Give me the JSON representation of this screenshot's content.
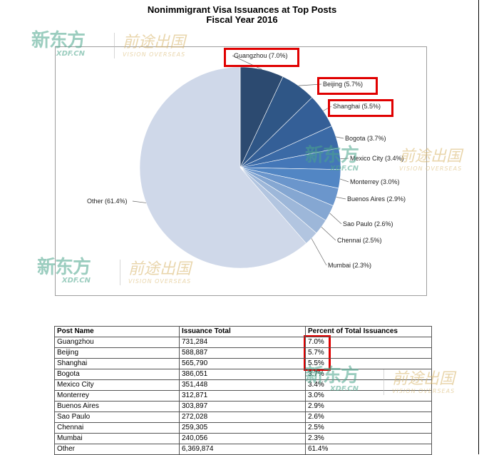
{
  "title_line1": "Nonimmigrant Visa Issuances at Top Posts",
  "title_line2": "Fiscal Year 2016",
  "watermark": {
    "cn": "新东方",
    "en": "XDF.CN",
    "cn2": "前途出国",
    "en2": "VISION OVERSEAS"
  },
  "chart_data": {
    "type": "pie",
    "slices": [
      {
        "label": "Guangzhou (7.0%)",
        "value": 7.0,
        "color": "#2c4a70"
      },
      {
        "label": "Beijing (5.7%)",
        "value": 5.7,
        "color": "#2f5686"
      },
      {
        "label": "Shanghai (5.5%)",
        "value": 5.5,
        "color": "#345f97"
      },
      {
        "label": "Bogota (3.7%)",
        "value": 3.7,
        "color": "#3b6aa6"
      },
      {
        "label": "Mexico City (3.4%)",
        "value": 3.4,
        "color": "#4477b8"
      },
      {
        "label": "Monterrey (3.0%)",
        "value": 3.0,
        "color": "#5286c4"
      },
      {
        "label": "Buenos Aires (2.9%)",
        "value": 2.9,
        "color": "#6b96cc"
      },
      {
        "label": "Sao Paulo (2.6%)",
        "value": 2.6,
        "color": "#85a7d2"
      },
      {
        "label": "Chennai (2.5%)",
        "value": 2.5,
        "color": "#9db7d9"
      },
      {
        "label": "Mumbai (2.3%)",
        "value": 2.3,
        "color": "#b2c5e0"
      },
      {
        "label": "Other (61.4%)",
        "value": 61.4,
        "color": "#cfd8e9"
      }
    ],
    "highlighted": [
      "Guangzhou (7.0%)",
      "Beijing (5.7%)",
      "Shanghai (5.5%)"
    ]
  },
  "table": {
    "headers": [
      "Post Name",
      "Issuance Total",
      "Percent of Total Issuances"
    ],
    "rows": [
      [
        "Guangzhou",
        "731,284",
        "7.0%"
      ],
      [
        "Beijing",
        "588,887",
        "5.7%"
      ],
      [
        "Shanghai",
        "565,790",
        "5.5%"
      ],
      [
        "Bogota",
        "386,051",
        "3.7%"
      ],
      [
        "Mexico City",
        "351,448",
        "3.4%"
      ],
      [
        "Monterrey",
        "312,871",
        "3.0%"
      ],
      [
        "Buenos Aires",
        "303,897",
        "2.9%"
      ],
      [
        "Sao Paulo",
        "272,028",
        "2.6%"
      ],
      [
        "Chennai",
        "259,305",
        "2.5%"
      ],
      [
        "Mumbai",
        "240,056",
        "2.3%"
      ],
      [
        "Other",
        "6,369,874",
        "61.4%"
      ]
    ],
    "highlighted_cells": [
      [
        0,
        2
      ],
      [
        1,
        2
      ],
      [
        2,
        2
      ]
    ]
  },
  "colors": {
    "highlight": "#e00000"
  }
}
